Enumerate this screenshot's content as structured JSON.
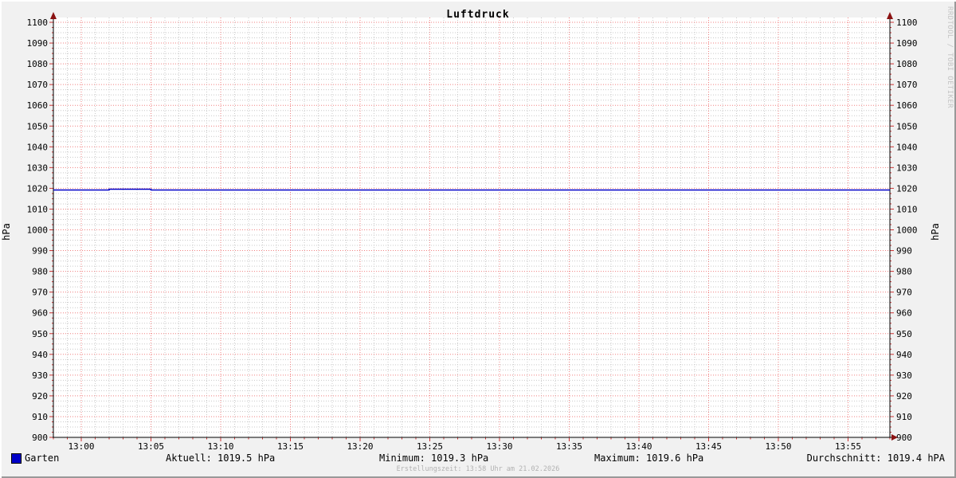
{
  "chart": {
    "title": "Luftdruck",
    "axis": {
      "left_label": "hPa",
      "right_label": "hPa",
      "y_ticks": [
        "1100",
        "1090",
        "1080",
        "1070",
        "1060",
        "1050",
        "1040",
        "1030",
        "1020",
        "1010",
        "1000",
        "990",
        "980",
        "970",
        "960",
        "950",
        "940",
        "930",
        "920",
        "910",
        "900"
      ],
      "x_ticks": [
        "13:00",
        "13:05",
        "13:10",
        "13:15",
        "13:20",
        "13:25",
        "13:30",
        "13:35",
        "13:40",
        "13:45",
        "13:50",
        "13:55"
      ]
    },
    "legend": {
      "label": "Garten"
    },
    "stats": [
      "Aktuell: 1019.5 hPa",
      "Minimum: 1019.3 hPa",
      "Maximum: 1019.6 hPa",
      "Durchschnitt: 1019.4 hPA"
    ],
    "footer": "Erstellungszeit: 13:58 Uhr am 21.02.2026",
    "watermark": "RRDTOOL / TOBI OETIKER",
    "colors": {
      "background": "#f1f1f1",
      "plot_background": "#ffffff",
      "major_grid": "#f08080",
      "minor_grid": "#c9c9c9",
      "axis": "#000000",
      "arrow": "#8b1212",
      "tick": "#cc3333",
      "series": "#0000c8",
      "footer_text": "#b2b2b2",
      "watermark_text": "#c4c4c4"
    }
  },
  "chart_data": {
    "type": "line",
    "title": "Luftdruck",
    "xlabel": "",
    "ylabel": "hPa",
    "ylim": [
      900,
      1100
    ],
    "y_major_step": 10,
    "y_minor_step": 2.5,
    "x_range": [
      "12:58",
      "13:58"
    ],
    "x_major_ticks": [
      "13:00",
      "13:05",
      "13:10",
      "13:15",
      "13:20",
      "13:25",
      "13:30",
      "13:35",
      "13:40",
      "13:45",
      "13:50",
      "13:55"
    ],
    "x_minor_step_minutes": 1,
    "grid": true,
    "legend_position": "bottom-left",
    "series": [
      {
        "name": "Garten",
        "color": "#0000c8",
        "points": [
          [
            "12:58",
            1019.5
          ],
          [
            "13:02",
            1019.5
          ],
          [
            "13:02",
            1019.6
          ],
          [
            "13:05",
            1019.6
          ],
          [
            "13:05",
            1019.5
          ],
          [
            "13:58",
            1019.5
          ]
        ]
      }
    ],
    "stats": {
      "current_hpa": 1019.5,
      "min_hpa": 1019.3,
      "max_hpa": 1019.6,
      "avg_hpa": 1019.4
    }
  }
}
